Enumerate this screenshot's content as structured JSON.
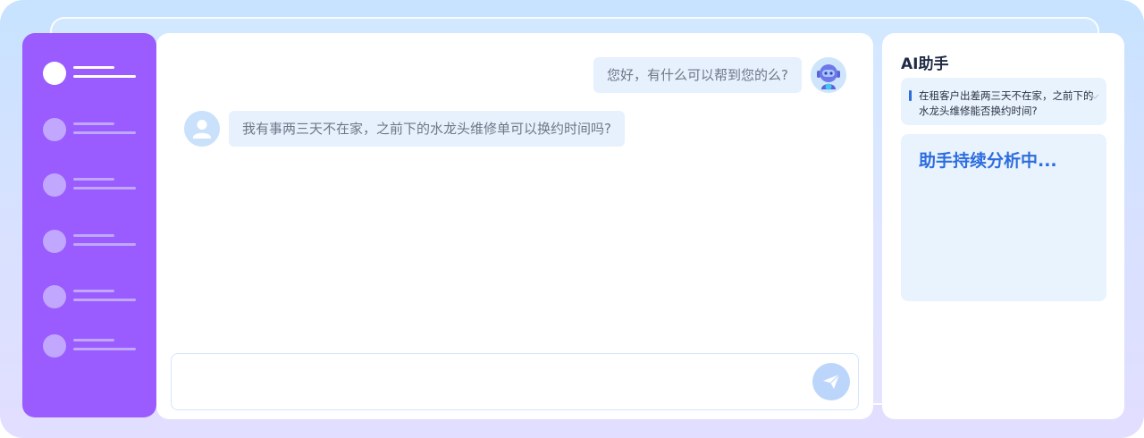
{
  "sidebar": {
    "items": [
      {
        "icon": "nav-dot-icon",
        "active": true
      },
      {
        "icon": "nav-dot-icon",
        "active": false
      },
      {
        "icon": "nav-dot-icon",
        "active": false
      },
      {
        "icon": "nav-dot-icon",
        "active": false
      },
      {
        "icon": "nav-dot-icon",
        "active": false
      },
      {
        "icon": "nav-dot-icon",
        "active": false
      }
    ]
  },
  "chat": {
    "messages": [
      {
        "role": "assistant",
        "text": "您好，有什么可以帮到您的么?",
        "avatar": "robot-avatar-icon"
      },
      {
        "role": "user",
        "text": "我有事两三天不在家，之前下的水龙头维修单可以换约时间吗?",
        "avatar": "user-avatar-icon"
      }
    ],
    "input": {
      "value": "",
      "placeholder": ""
    },
    "send_icon": "paper-plane-icon"
  },
  "assistant_panel": {
    "title": "AI助手",
    "query_text": "在租客户出差两三天不在家，之前下的水龙头维修能否换约时间?",
    "status": "助手持续分析中..."
  },
  "colors": {
    "sidebar": "#9a5cff",
    "bubble": "#e6f1fd",
    "accent": "#2d6cdf",
    "background_top": "#c7e3ff",
    "background_bottom": "#e2deff"
  }
}
